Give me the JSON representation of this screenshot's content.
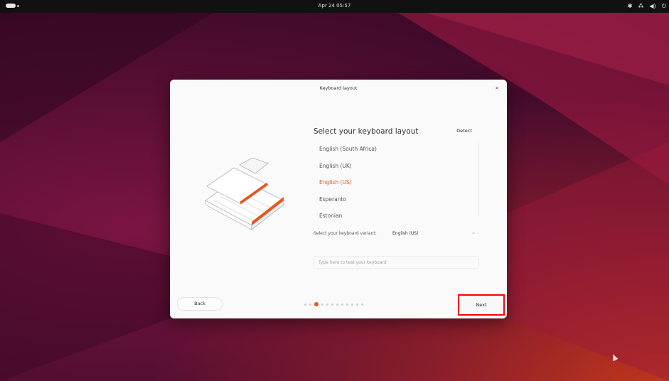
{
  "topbar": {
    "clock": "Apr 24 05:57",
    "icons": [
      "accessibility-icon",
      "network-icon",
      "volume-icon",
      "power-icon"
    ]
  },
  "dialog": {
    "title": "Keyboard layout",
    "close_label": "×",
    "heading": "Select your keyboard layout",
    "detect_label": "Detect",
    "layouts": [
      {
        "label": "English (South Africa)",
        "selected": false
      },
      {
        "label": "English (UK)",
        "selected": false
      },
      {
        "label": "English (US)",
        "selected": true
      },
      {
        "label": "Esperanto",
        "selected": false
      },
      {
        "label": "Estonian",
        "selected": false
      }
    ],
    "variant_label": "Select your keyboard variant:",
    "variant_value": "English (US)",
    "test_placeholder": "Type here to test your keyboard",
    "back_label": "Back",
    "next_label": "Next",
    "progress": {
      "total_steps": 12,
      "current_step": 3
    }
  },
  "colors": {
    "accent": "#e95420",
    "highlight_box": "#ff0000"
  }
}
